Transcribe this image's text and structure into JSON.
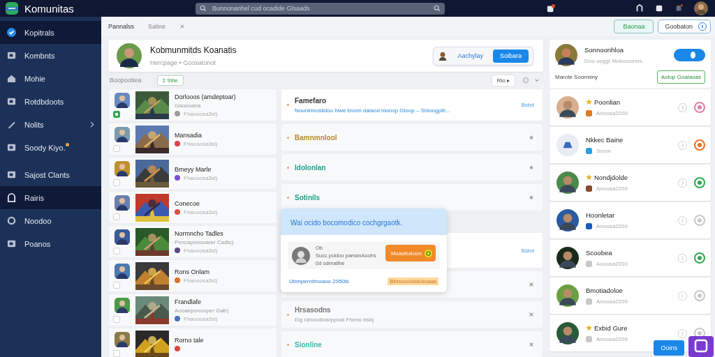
{
  "brand": "Komunitas",
  "search": {
    "placeholder": "Bunnonanhel cud ocadide Glsaads"
  },
  "sidebar": {
    "items": [
      {
        "label": "Kopitrals",
        "selected": true,
        "chevron": false,
        "dot": false
      },
      {
        "label": "Kombnts",
        "selected": false,
        "chevron": false,
        "dot": false
      },
      {
        "label": "Mohie",
        "selected": false,
        "chevron": false,
        "dot": false
      },
      {
        "label": "Rotdbdoots",
        "selected": false,
        "chevron": false,
        "dot": false
      },
      {
        "label": "Nolits",
        "selected": false,
        "chevron": true,
        "dot": false
      },
      {
        "label": "Soody Kiyo.",
        "selected": false,
        "chevron": false,
        "dot": true
      },
      {
        "label": "Sajost Clants",
        "selected": false,
        "chevron": false,
        "dot": false
      },
      {
        "label": "Rairis",
        "selected": true,
        "chevron": false,
        "dot": false
      },
      {
        "label": "Noodoo",
        "selected": false,
        "chevron": false,
        "dot": false
      },
      {
        "label": "Poanos",
        "selected": false,
        "chevron": false,
        "dot": false
      }
    ]
  },
  "tabs": [
    {
      "label": "Pannalss",
      "selected": true
    },
    {
      "label": "Saline",
      "selected": false
    }
  ],
  "toolbar": {
    "primary": "Baonaa",
    "secondary": "Goobaton"
  },
  "header": {
    "title": "Kobmunmitds Koanatis",
    "subtitle": "Hercpage • Goosatonot",
    "link": "Aachylay",
    "button": "Soibara"
  },
  "filter": {
    "label": "Boopootiea",
    "chip": "2 Stiie",
    "sort": "Rio ▸"
  },
  "games": [
    {
      "title": "Dorlooos (amdeptoar)",
      "subtitle": "Gaoooana",
      "reading": "Fhaooosa3sl)",
      "color": "#9a9a9a",
      "checked": true
    },
    {
      "title": "Mansadia",
      "reading": "Fhaooosa3sl)",
      "color": "#d94050",
      "checked": false
    },
    {
      "title": "Bmeyy Marle",
      "reading": "Fhaooosa3sl)",
      "color": "#7a4fd6",
      "checked": false
    },
    {
      "title": "Conecoe",
      "reading": "Fhaooosa3sl)",
      "color": "#d95040",
      "checked": false
    },
    {
      "title": "Normncho Tadles",
      "subtitle": "Pxncaponooarer Cadts)",
      "reading": "Fhaooosa3sl)",
      "color": "#5a4a80",
      "checked": false
    },
    {
      "title": "Rons Onlam",
      "reading": "Fhaooosa3sl)",
      "color": "#d9732a",
      "checked": false
    },
    {
      "title": "Frandlafe",
      "subtitle": "Aooaeponooper Gatr)",
      "reading": "Fhaooosa3sl)",
      "color": "#4a70c0",
      "checked": false
    },
    {
      "title": "Rorno tale",
      "color": "#d94a3a",
      "checked": false
    }
  ],
  "details": [
    {
      "title": "Famefaro",
      "subtitle": "Nounlnnosiidoo Nwe bnom daland hionop Gloop – Shloogpib...",
      "color": "#333333",
      "kind": "link",
      "action": "Bsbd"
    },
    {
      "title": "Bamnmnlool",
      "color": "#b8892a",
      "kind": "pin"
    },
    {
      "title": "Idolonlan",
      "color": "#1fa08a",
      "kind": "pin"
    },
    {
      "title": "Sotinils",
      "color": "#1fa08a",
      "kind": "pin"
    },
    {
      "kind": "link",
      "action": "Bsbd"
    },
    {
      "kind": "close"
    },
    {
      "title": "Hrsasodns",
      "subtitle": "Eig rdnoodiosrppoal Fheno bsbj",
      "color": "#777777",
      "kind": "close"
    },
    {
      "title": "Sionline",
      "color": "#3bb8a8",
      "kind": "close"
    }
  ],
  "popup": {
    "title": "Wai ocido bocomodico cochgrgaotk.",
    "name": "Ob",
    "line1": "Succ pckloo pamanAoohs",
    "line2": "0d odnratlhe",
    "button": "Moaoboloon",
    "link": "Ubmperrdmoaoo 2950ls",
    "tag": "Blnnoooodoloeoaaa"
  },
  "profile": {
    "name": "Sonnoonhloa",
    "subtitle": "Doo ooggt Moloooonns.",
    "on": true,
    "note": "Marote Soorminy",
    "button": "Aotop Goalaoas"
  },
  "friends": [
    {
      "name": "Poonlian",
      "starred": true,
      "status": "Anoosa2200",
      "color": "#e37fa5"
    },
    {
      "name": "Nkkec Baine",
      "starred": false,
      "status": "Soom",
      "color": "#f07020"
    },
    {
      "name": "Nondjdolde",
      "starred": true,
      "status": "Anoosa2200",
      "color": "#2fa84f"
    },
    {
      "name": "Hoonletar",
      "starred": false,
      "status": "Anoosa2200",
      "color": "#c8c8c8"
    },
    {
      "name": "Scoobea",
      "starred": false,
      "status": "Anoosa2200",
      "color": "#2fa84f"
    },
    {
      "name": "Bmotiadoloe",
      "starred": false,
      "status": "Anoosa2200",
      "color": "#c8c8c8"
    },
    {
      "name": "Exbid Gure",
      "starred": true,
      "status": "Anoosa2200",
      "color": "#c8c8c8"
    }
  ],
  "footer_button": "Ooins"
}
